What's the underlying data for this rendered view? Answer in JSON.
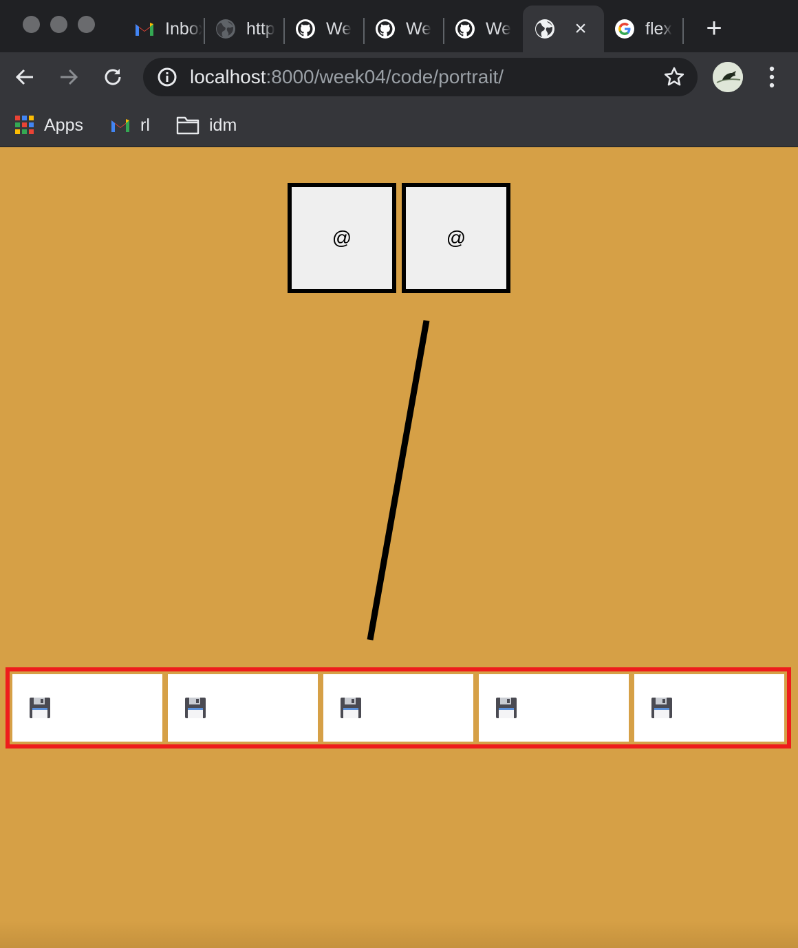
{
  "browser": {
    "tabs": [
      {
        "title": "Inbox",
        "icon": "gmail-icon"
      },
      {
        "title": "http",
        "icon": "globe-icon"
      },
      {
        "title": "We",
        "icon": "github-icon"
      },
      {
        "title": "We",
        "icon": "github-icon"
      },
      {
        "title": "We",
        "icon": "github-icon"
      },
      {
        "title": "",
        "icon": "globe-icon",
        "active": true
      },
      {
        "title": "flex",
        "icon": "google-icon"
      }
    ],
    "new_tab_symbol": "+",
    "close_symbol": "×",
    "url_host": "localhost",
    "url_path": ":8000/week04/code/portrait/",
    "bookmarks": [
      {
        "label": "Apps",
        "icon": "apps-grid-icon"
      },
      {
        "label": "rl",
        "icon": "gmail-icon"
      },
      {
        "label": "idm",
        "icon": "folder-icon"
      }
    ]
  },
  "page": {
    "background_color": "#d6a046",
    "eyes": [
      {
        "label": "@"
      },
      {
        "label": "@"
      }
    ],
    "strip_border_color": "#ee1c1c",
    "strip_cells": [
      {
        "icon": "floppy-disk-icon"
      },
      {
        "icon": "floppy-disk-icon"
      },
      {
        "icon": "floppy-disk-icon"
      },
      {
        "icon": "floppy-disk-icon"
      },
      {
        "icon": "floppy-disk-icon"
      }
    ]
  }
}
